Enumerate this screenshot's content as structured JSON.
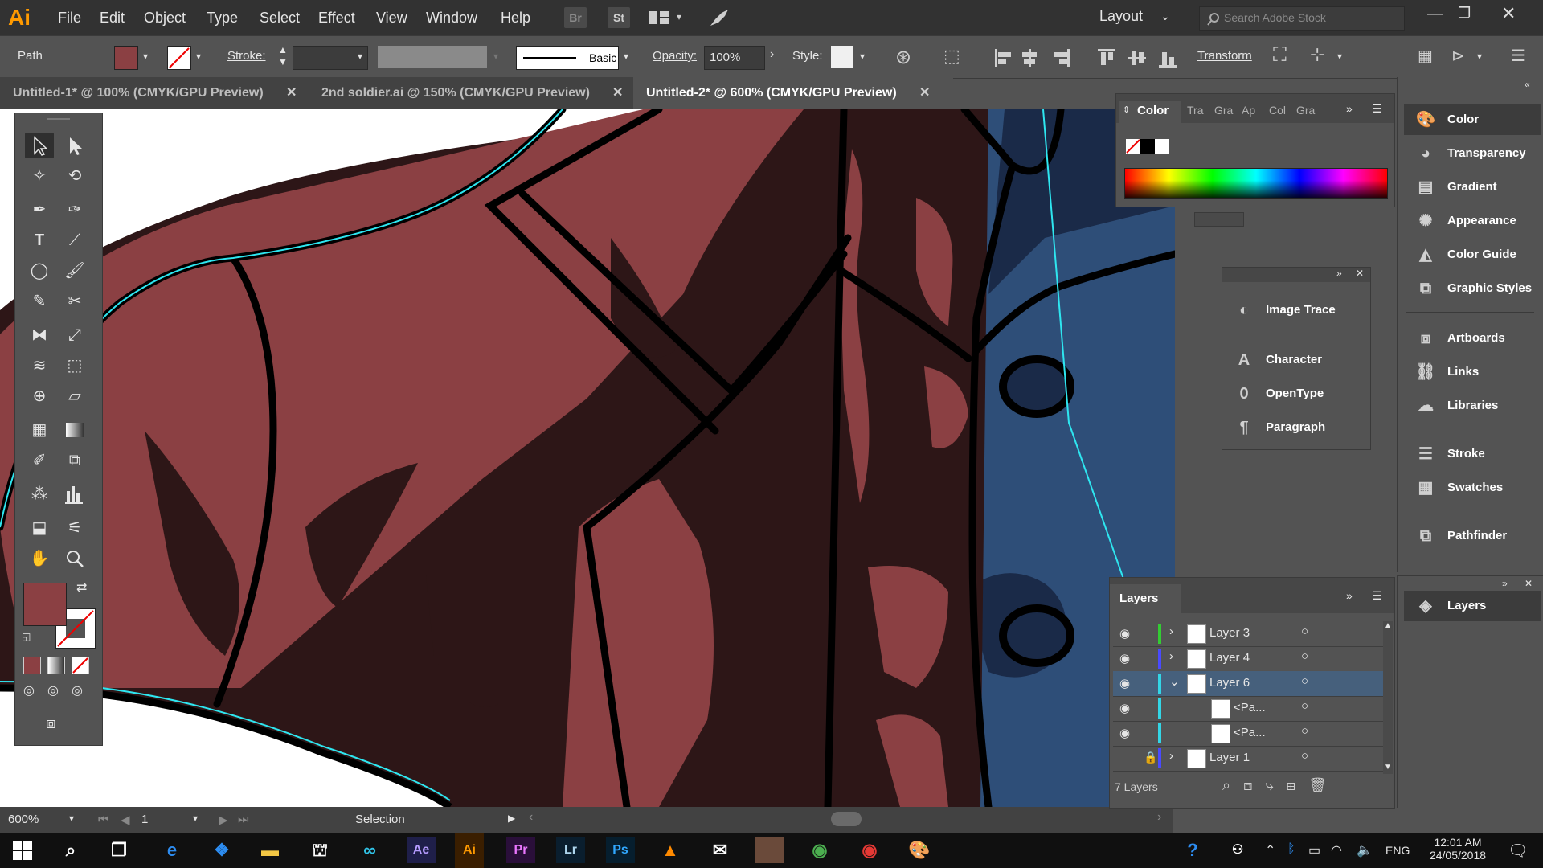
{
  "app": {
    "logo": "Ai",
    "menus": [
      "File",
      "Edit",
      "Object",
      "Type",
      "Select",
      "Effect",
      "View",
      "Window",
      "Help"
    ],
    "bridge_btn": "Br",
    "stock_btn": "St",
    "workspace": "Layout",
    "search_placeholder": "Search Adobe Stock"
  },
  "control": {
    "selection_type": "Path",
    "stroke_label": "Stroke:",
    "brush_name": "Basic",
    "opacity_label": "Opacity:",
    "opacity_value": "100%",
    "style_label": "Style:",
    "transform_label": "Transform",
    "fill_color": "#8b4043"
  },
  "tabs": [
    {
      "label": "Untitled-1* @ 100% (CMYK/GPU Preview)"
    },
    {
      "label": "2nd soldier.ai @ 150% (CMYK/GPU Preview)"
    },
    {
      "label": "Untitled-2* @ 600% (CMYK/GPU Preview)",
      "active": true
    }
  ],
  "status": {
    "zoom": "600%",
    "artboard": "1",
    "tool": "Selection"
  },
  "color_panel": {
    "tabs": [
      "Color",
      "Tra",
      "Gra",
      "Ap",
      "Col",
      "Gra"
    ]
  },
  "float_panel": {
    "items": [
      "Image Trace",
      "Character",
      "OpenType",
      "Paragraph"
    ]
  },
  "dock": {
    "items": [
      "Color",
      "Transparency",
      "Gradient",
      "Appearance",
      "Color Guide",
      "Graphic Styles",
      "Artboards",
      "Links",
      "Libraries",
      "Stroke",
      "Swatches",
      "Pathfinder"
    ],
    "layers": "Layers"
  },
  "layers_panel": {
    "title": "Layers",
    "rows": [
      {
        "name": "Layer 3",
        "color": "#33cc33",
        "expand": "›"
      },
      {
        "name": "Layer 4",
        "color": "#4a4aff",
        "expand": "›"
      },
      {
        "name": "Layer 6",
        "color": "#33d6e6",
        "expand": "⌄",
        "selected": true
      },
      {
        "name": "<Pa...",
        "color": "#33d6e6",
        "expand": ""
      },
      {
        "name": "<Pa...",
        "color": "#33d6e6",
        "expand": ""
      },
      {
        "name": "Layer 1",
        "color": "#4a4aff",
        "expand": "›",
        "locked": true
      }
    ],
    "count": "7 Layers"
  },
  "taskbar": {
    "apps": [
      "Ae",
      "Ai",
      "Pr",
      "Lr",
      "Ps"
    ],
    "lang": "ENG",
    "time": "12:01 AM",
    "date": "24/05/2018"
  },
  "colors": {
    "shirt_red": "#8b4043",
    "shirt_dark": "#2d1617",
    "blue": "#2e4e78",
    "navy": "#1a2a48",
    "accent_cyan": "#2ee6f0"
  }
}
